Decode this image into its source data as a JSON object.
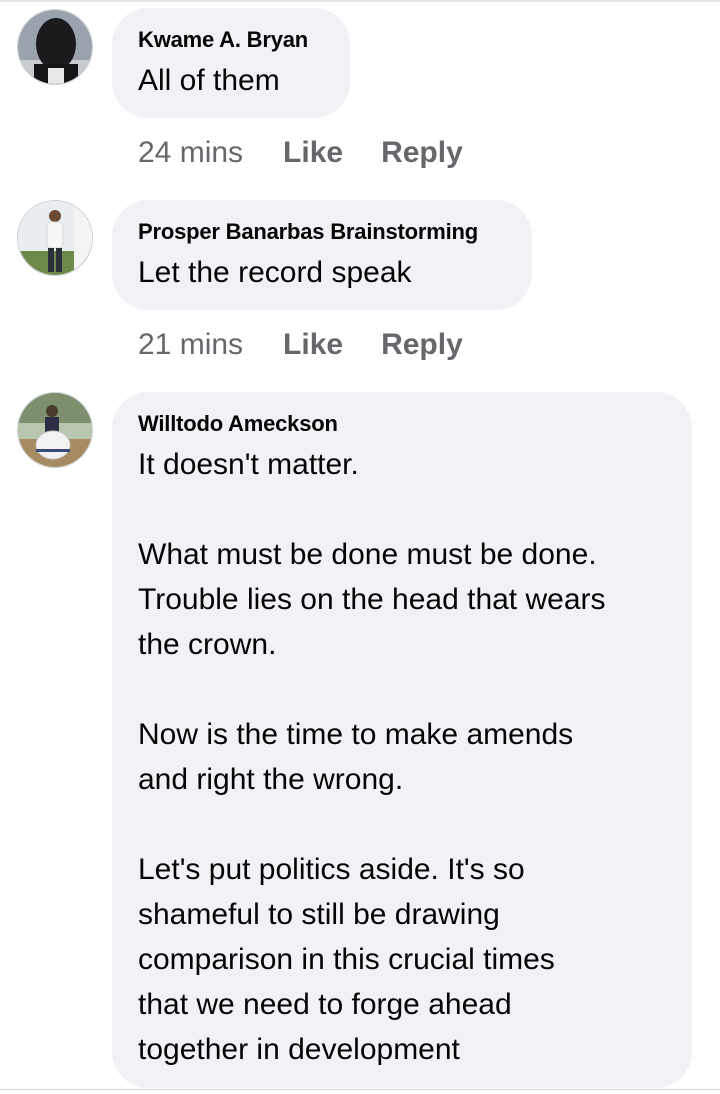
{
  "comments": [
    {
      "author": "Kwame A. Bryan",
      "text": "All of them",
      "time": "24 mins",
      "like_label": "Like",
      "reply_label": "Reply"
    },
    {
      "author": "Prosper Banarbas Brainstorming",
      "text": "Let the record speak",
      "time": "21 mins",
      "like_label": "Like",
      "reply_label": "Reply"
    },
    {
      "author": "Willtodo Ameckson",
      "text": "It doesn't matter.\n\nWhat must be done must be done.\nTrouble lies on the head that wears\nthe crown.\n\nNow is the time to make amends\nand right the wrong.\n\nLet's put politics aside. It's so\nshameful to still be drawing\ncomparison in this crucial times\nthat we need to forge ahead\ntogether in development"
    }
  ],
  "colors": {
    "bubble_bg": "#f0f2f5",
    "meta_text": "#65676b",
    "primary_text": "#050505"
  },
  "icons": {
    "avatar_1": "avatar-photo-dark",
    "avatar_2": "avatar-photo-standing-man",
    "avatar_3": "avatar-photo-outdoor-person"
  }
}
